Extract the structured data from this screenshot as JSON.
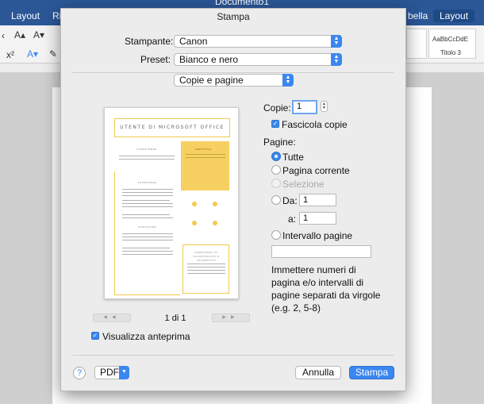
{
  "window": {
    "title": "Documento1",
    "tabs": [
      "Layout",
      "Ri",
      "bella",
      "Layout"
    ],
    "styles": [
      "AaBbCcDdE",
      "Titolo 3"
    ]
  },
  "dialog": {
    "title": "Stampa",
    "printer_label": "Stampante:",
    "printer_value": "Canon",
    "preset_label": "Preset:",
    "preset_value": "Bianco e nero",
    "section_value": "Copie e pagine",
    "preview": {
      "header_text": "UTENTE DI MICROSOFT OFFICE",
      "sections": [
        "COMPETENZE",
        "OBIETTIVO",
        "ESPERIENZA",
        "ISTRUZIONE",
        "ESPERIENZA DI VOLONTARIATO O LEADERSHIP"
      ]
    },
    "page_counter": "1 di 1",
    "show_preview_label": "Visualizza anteprima",
    "copies_label": "Copie:",
    "copies_value": "1",
    "collate_label": "Fascicola copie",
    "pages_label": "Pagine:",
    "pages_options": [
      "Tutte",
      "Pagina corrente",
      "Selezione"
    ],
    "from_label": "Da:",
    "from_value": "1",
    "to_label": "a:",
    "to_value": "1",
    "range_label": "Intervallo pagine",
    "range_value": "",
    "hint": "Immettere numeri di pagina e/o intervalli di pagine separati da virgole (e.g. 2, 5-8)",
    "help_label": "?",
    "pdf_label": "PDF",
    "cancel_label": "Annulla",
    "print_label": "Stampa"
  },
  "colors": {
    "accent": "#3b87f0",
    "word_blue": "#2b5797",
    "preview_yellow": "#f6d061"
  },
  "icons": [
    "help-icon",
    "chevron-updown-icon",
    "checkmark-icon",
    "prev-page-icon",
    "next-page-icon"
  ]
}
